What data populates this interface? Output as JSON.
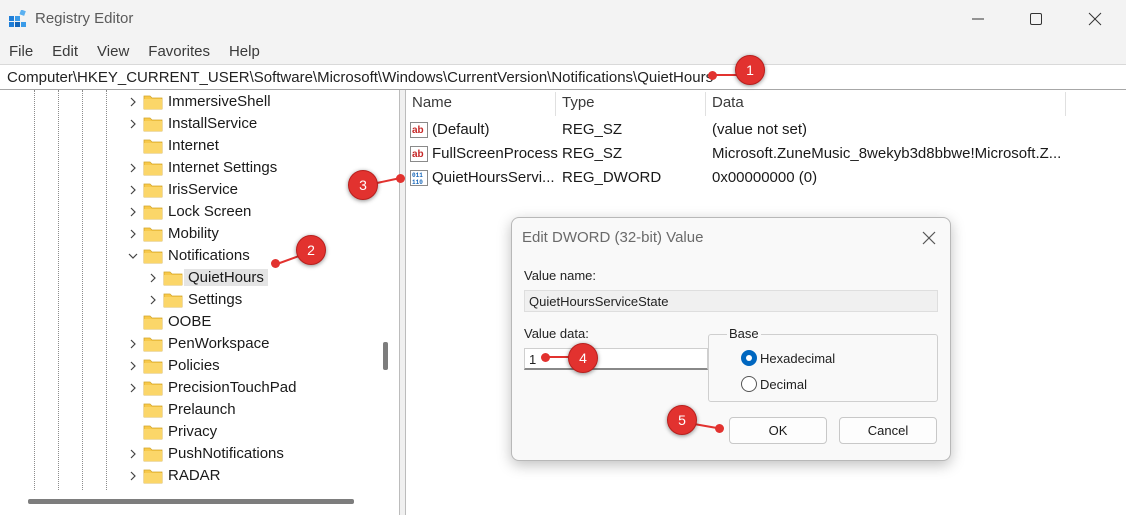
{
  "window": {
    "title": "Registry Editor"
  },
  "menu": [
    "File",
    "Edit",
    "View",
    "Favorites",
    "Help"
  ],
  "address": "Computer\\HKEY_CURRENT_USER\\Software\\Microsoft\\Windows\\CurrentVersion\\Notifications\\QuietHours",
  "tree": {
    "items": [
      {
        "label": "ImmersiveShell",
        "expander": "collapsed",
        "selected": false
      },
      {
        "label": "InstallService",
        "expander": "collapsed",
        "selected": false
      },
      {
        "label": "Internet",
        "expander": "none",
        "selected": false
      },
      {
        "label": "Internet Settings",
        "expander": "collapsed",
        "selected": false
      },
      {
        "label": "IrisService",
        "expander": "collapsed",
        "selected": false
      },
      {
        "label": "Lock Screen",
        "expander": "collapsed",
        "selected": false
      },
      {
        "label": "Mobility",
        "expander": "collapsed",
        "selected": false
      },
      {
        "label": "Notifications",
        "expander": "expanded",
        "selected": false
      },
      {
        "label": "QuietHours",
        "expander": "collapsed",
        "selected": true
      },
      {
        "label": "Settings",
        "expander": "collapsed",
        "selected": false
      },
      {
        "label": "OOBE",
        "expander": "none",
        "selected": false
      },
      {
        "label": "PenWorkspace",
        "expander": "collapsed",
        "selected": false
      },
      {
        "label": "Policies",
        "expander": "collapsed",
        "selected": false
      },
      {
        "label": "PrecisionTouchPad",
        "expander": "collapsed",
        "selected": false
      },
      {
        "label": "Prelaunch",
        "expander": "none",
        "selected": false
      },
      {
        "label": "Privacy",
        "expander": "none",
        "selected": false
      },
      {
        "label": "PushNotifications",
        "expander": "collapsed",
        "selected": false
      },
      {
        "label": "RADAR",
        "expander": "collapsed",
        "selected": false
      }
    ]
  },
  "list": {
    "columns": [
      "Name",
      "Type",
      "Data"
    ],
    "rows": [
      {
        "icon": "string-value-icon",
        "name": "(Default)",
        "type": "REG_SZ",
        "data": "(value not set)"
      },
      {
        "icon": "string-value-icon",
        "name": "FullScreenProcess",
        "type": "REG_SZ",
        "data": "Microsoft.ZuneMusic_8wekyb3d8bbwe!Microsoft.Z..."
      },
      {
        "icon": "binary-value-icon",
        "name": "QuietHoursServi...",
        "type": "REG_DWORD",
        "data": "0x00000000 (0)"
      }
    ]
  },
  "dialog": {
    "title": "Edit DWORD (32-bit) Value",
    "value_name_label": "Value name:",
    "value_name": "QuietHoursServiceState",
    "value_data_label": "Value data:",
    "value_data": "1",
    "base_label": "Base",
    "radio_hex": "Hexadecimal",
    "radio_dec": "Decimal",
    "selected_base": "Hexadecimal",
    "ok_label": "OK",
    "cancel_label": "Cancel"
  },
  "callouts": [
    "1",
    "2",
    "3",
    "4",
    "5"
  ],
  "colors": {
    "callout": "#e2322f",
    "folder": "#f8c94a",
    "accent": "#0067c0"
  }
}
